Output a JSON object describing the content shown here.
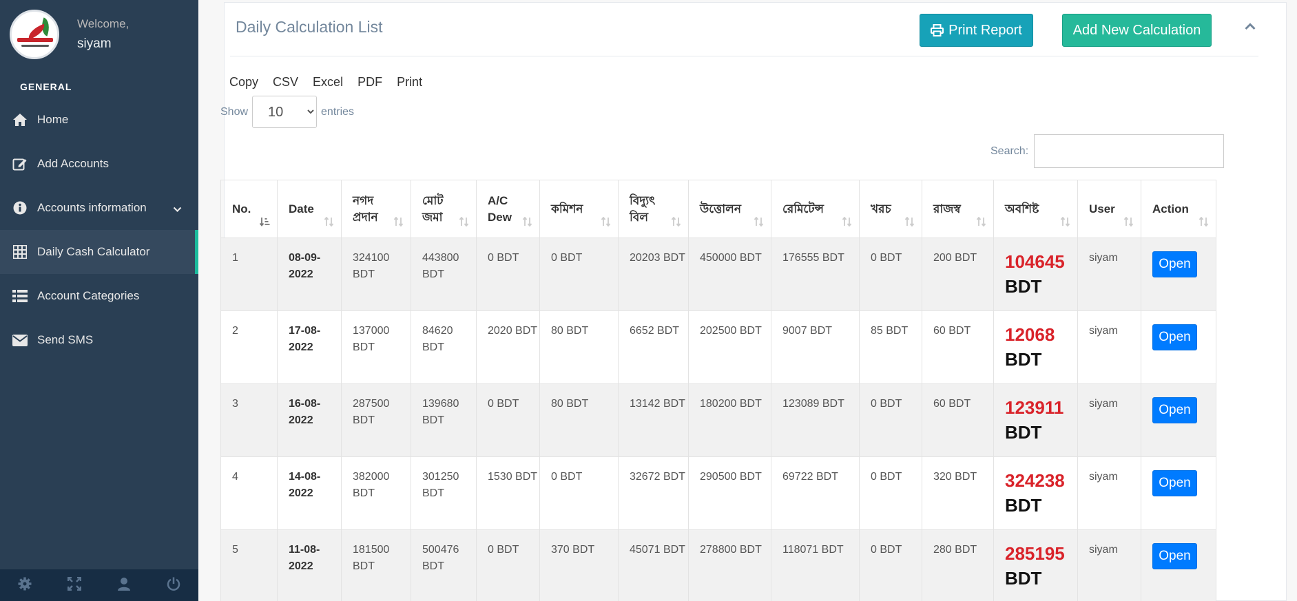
{
  "sidebar": {
    "welcome": "Welcome,",
    "username": "siyam",
    "section": "GENERAL",
    "items": [
      {
        "label": "Home",
        "icon": "home-icon"
      },
      {
        "label": "Add Accounts",
        "icon": "edit-icon"
      },
      {
        "label": "Accounts information",
        "icon": "info-icon"
      },
      {
        "label": "Daily Cash Calculator",
        "icon": "calculator-icon",
        "active": true
      },
      {
        "label": "Account Categories",
        "icon": "list-icon"
      },
      {
        "label": "Send SMS",
        "icon": "envelope-icon"
      }
    ],
    "footer_icons": [
      "gear-icon",
      "fullscreen-icon",
      "user-icon",
      "power-icon"
    ]
  },
  "panel": {
    "title": "Daily Calculation List",
    "print_label": "Print Report",
    "add_label": "Add New Calculation"
  },
  "table_tools": {
    "export": [
      "Copy",
      "CSV",
      "Excel",
      "PDF",
      "Print"
    ],
    "show_label": "Show",
    "entries_value": "10",
    "entries_label": "entries",
    "search_label": "Search:"
  },
  "table": {
    "headers": [
      "No.",
      "Date",
      "নগদ প্রদান",
      "মোট জমা",
      "A/C Dew",
      "কমিশন",
      "বিদ্যুৎ বিল",
      "উত্তোলন",
      "রেমিটেন্স",
      "খরচ",
      "রাজস্ব",
      "অবশিষ্ট",
      "User",
      "Action"
    ],
    "open_label": "Open",
    "rows": [
      {
        "no": "1",
        "date": "08-09-2022",
        "cash": "324100 BDT",
        "deposit": "443800 BDT",
        "acdew": "0 BDT",
        "commission": "0 BDT",
        "electric": "20203 BDT",
        "withdraw": "450000 BDT",
        "remit": "176555 BDT",
        "expense": "0 BDT",
        "revenue": "200 BDT",
        "balance": "104645",
        "unit": "BDT",
        "user": "siyam"
      },
      {
        "no": "2",
        "date": "17-08-2022",
        "cash": "137000 BDT",
        "deposit": "84620 BDT",
        "acdew": "2020 BDT",
        "commission": "80 BDT",
        "electric": "6652 BDT",
        "withdraw": "202500 BDT",
        "remit": "9007 BDT",
        "expense": "85 BDT",
        "revenue": "60 BDT",
        "balance": "12068",
        "unit": "BDT",
        "user": "siyam"
      },
      {
        "no": "3",
        "date": "16-08-2022",
        "cash": "287500 BDT",
        "deposit": "139680 BDT",
        "acdew": "0 BDT",
        "commission": "80 BDT",
        "electric": "13142 BDT",
        "withdraw": "180200 BDT",
        "remit": "123089 BDT",
        "expense": "0 BDT",
        "revenue": "60 BDT",
        "balance": "123911",
        "unit": "BDT",
        "user": "siyam"
      },
      {
        "no": "4",
        "date": "14-08-2022",
        "cash": "382000 BDT",
        "deposit": "301250 BDT",
        "acdew": "1530 BDT",
        "commission": "0 BDT",
        "electric": "32672 BDT",
        "withdraw": "290500 BDT",
        "remit": "69722 BDT",
        "expense": "0 BDT",
        "revenue": "320 BDT",
        "balance": "324238",
        "unit": "BDT",
        "user": "siyam"
      },
      {
        "no": "5",
        "date": "11-08-2022",
        "cash": "181500 BDT",
        "deposit": "500476 BDT",
        "acdew": "0 BDT",
        "commission": "370 BDT",
        "electric": "45071 BDT",
        "withdraw": "278800 BDT",
        "remit": "118071 BDT",
        "expense": "0 BDT",
        "revenue": "280 BDT",
        "balance": "285195",
        "unit": "BDT",
        "user": "siyam"
      }
    ]
  },
  "colors": {
    "sidebar_bg": "#2a3f54",
    "accent": "#1abb9c",
    "print_button": "#17a2b8",
    "add_button": "#26b99a",
    "balance_red": "#d9232a",
    "open_button": "#007bff"
  }
}
